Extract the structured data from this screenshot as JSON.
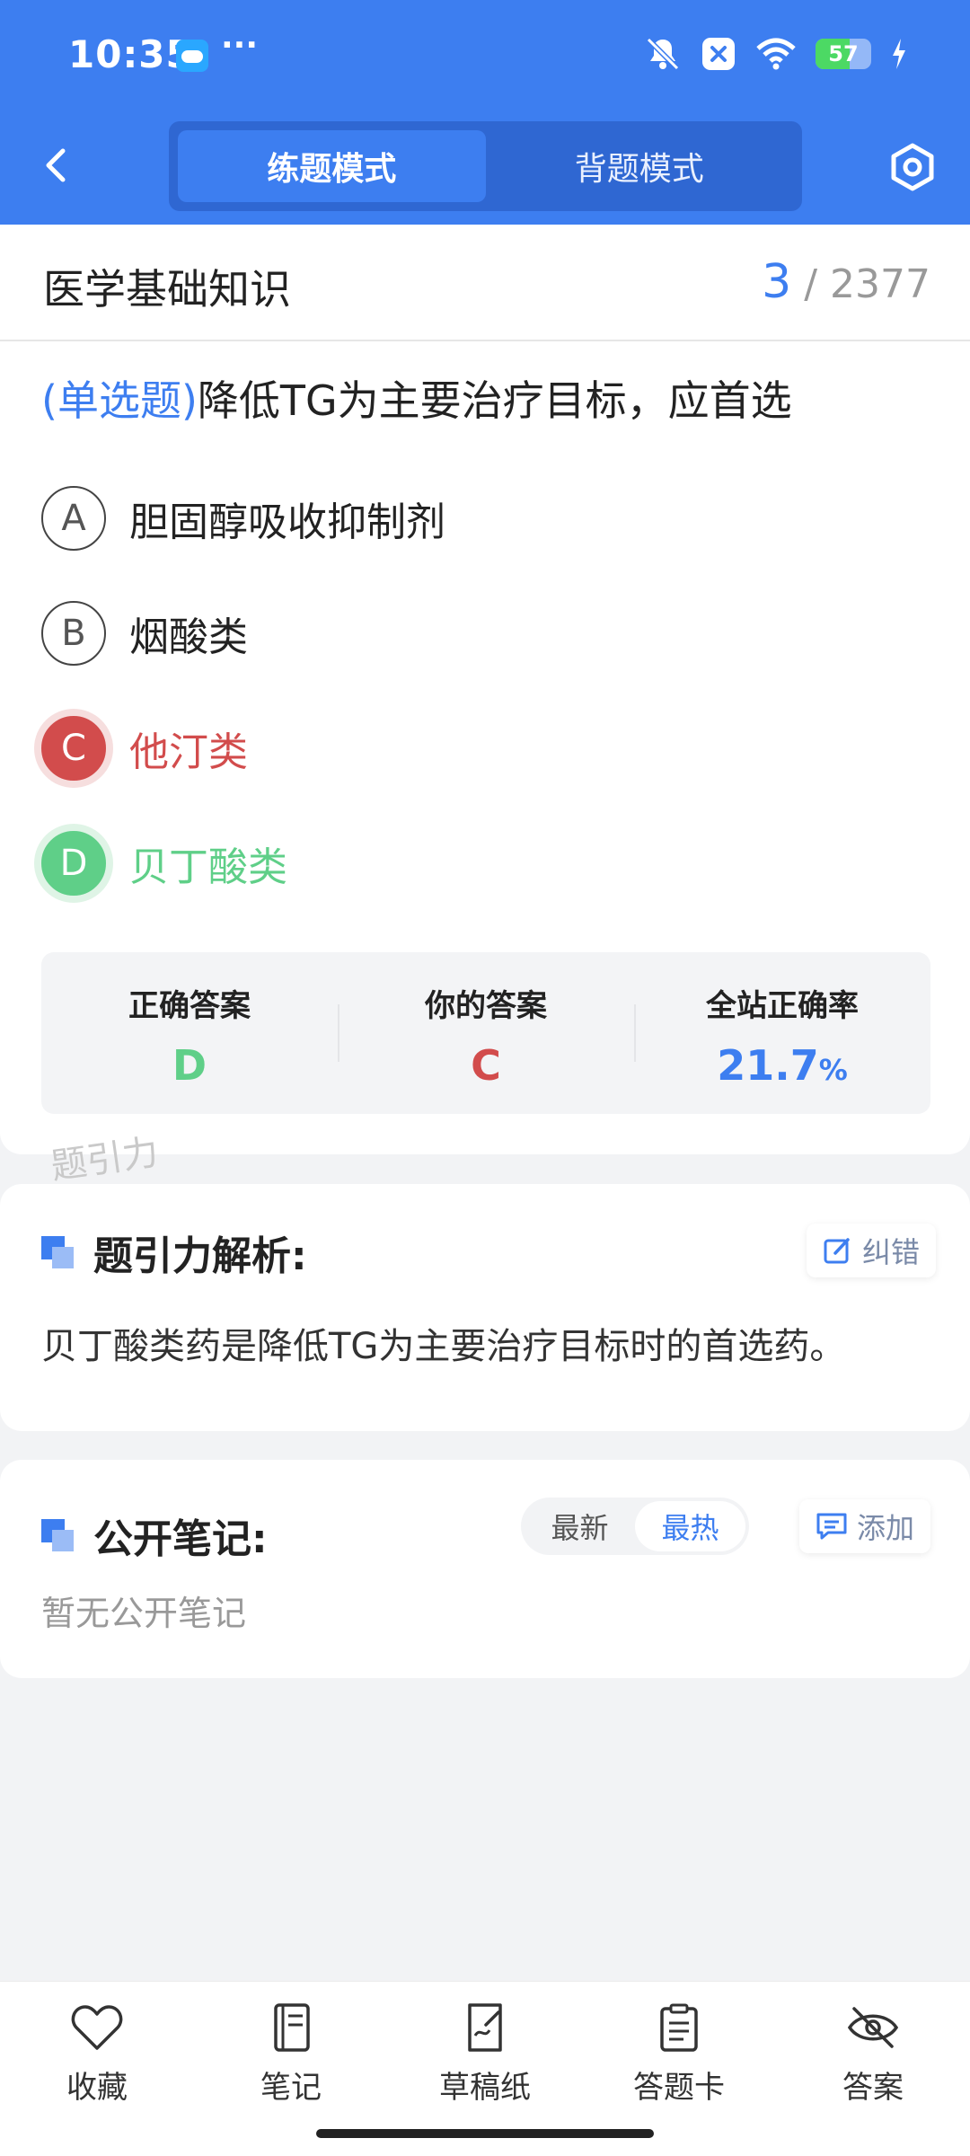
{
  "status": {
    "time": "10:35",
    "dots": "···",
    "battery": "57"
  },
  "header": {
    "tabs": [
      "练题模式",
      "背题模式"
    ],
    "active_tab": 0
  },
  "question": {
    "category": "医学基础知识",
    "index": "3",
    "total": "/ 2377",
    "type": "(单选题)",
    "text": "降低TG为主要治疗目标，应首选",
    "options": [
      {
        "letter": "A",
        "text": "胆固醇吸收抑制剂",
        "state": "normal"
      },
      {
        "letter": "B",
        "text": "烟酸类",
        "state": "normal"
      },
      {
        "letter": "C",
        "text": "他汀类",
        "state": "wrong"
      },
      {
        "letter": "D",
        "text": "贝丁酸类",
        "state": "correct"
      }
    ]
  },
  "stats": {
    "correct_label": "正确答案",
    "correct_value": "D",
    "yours_label": "你的答案",
    "yours_value": "C",
    "rate_label": "全站正确率",
    "rate_value": "21.7",
    "rate_unit": "%"
  },
  "watermark": "题引力",
  "explanation": {
    "title": "题引力解析:",
    "report_label": "纠错",
    "text": "贝丁酸类药是降低TG为主要治疗目标时的首选药。"
  },
  "notes": {
    "title": "公开笔记:",
    "sort": [
      "最新",
      "最热"
    ],
    "active_sort": 1,
    "add_label": "添加",
    "empty": "暂无公开笔记"
  },
  "bottom": [
    {
      "label": "收藏",
      "icon": "heart-icon"
    },
    {
      "label": "笔记",
      "icon": "notebook-icon"
    },
    {
      "label": "草稿纸",
      "icon": "draft-icon"
    },
    {
      "label": "答题卡",
      "icon": "answer-card-icon"
    },
    {
      "label": "答案",
      "icon": "eye-off-icon"
    }
  ],
  "colors": {
    "primary": "#3d7ef0",
    "wrong": "#d24c4c",
    "correct": "#5fcf88"
  }
}
